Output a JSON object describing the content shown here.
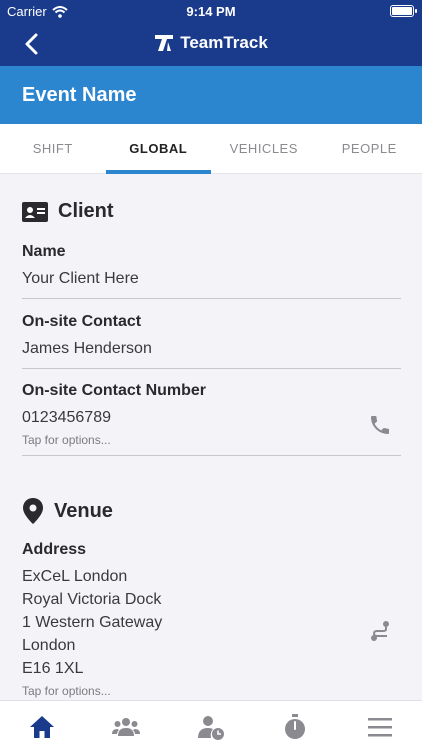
{
  "status_bar": {
    "carrier": "Carrier",
    "time": "9:14 PM",
    "battery_level": 0.95
  },
  "nav": {
    "app_name": "TeamTrack",
    "back_icon": "chevron-left-icon"
  },
  "header": {
    "title": "Event Name"
  },
  "tabs": [
    {
      "label": "SHIFT",
      "active": false
    },
    {
      "label": "GLOBAL",
      "active": true
    },
    {
      "label": "VEHICLES",
      "active": false
    },
    {
      "label": "PEOPLE",
      "active": false
    }
  ],
  "client": {
    "heading": "Client",
    "icon": "id-card-icon",
    "name_label": "Name",
    "name_value": "Your Client Here",
    "contact_label": "On-site Contact",
    "contact_value": "James Henderson",
    "number_label": "On-site Contact Number",
    "number_value": "0123456789",
    "number_hint": "Tap for options...",
    "number_icon": "phone-icon"
  },
  "venue": {
    "heading": "Venue",
    "icon": "map-pin-icon",
    "address_label": "Address",
    "address_lines": [
      "ExCeL London",
      "Royal Victoria Dock",
      "1 Western Gateway",
      "London",
      "E16 1XL"
    ],
    "address_hint": "Tap for options...",
    "address_icon": "route-icon"
  },
  "tab_bar": [
    {
      "name": "home-icon",
      "active": true
    },
    {
      "name": "team-icon",
      "active": false
    },
    {
      "name": "user-clock-icon",
      "active": false
    },
    {
      "name": "stopwatch-icon",
      "active": false
    },
    {
      "name": "menu-icon",
      "active": false
    }
  ],
  "colors": {
    "navy": "#1a3a8c",
    "accent": "#2b86cf",
    "icon_gray": "#8a8a90"
  }
}
